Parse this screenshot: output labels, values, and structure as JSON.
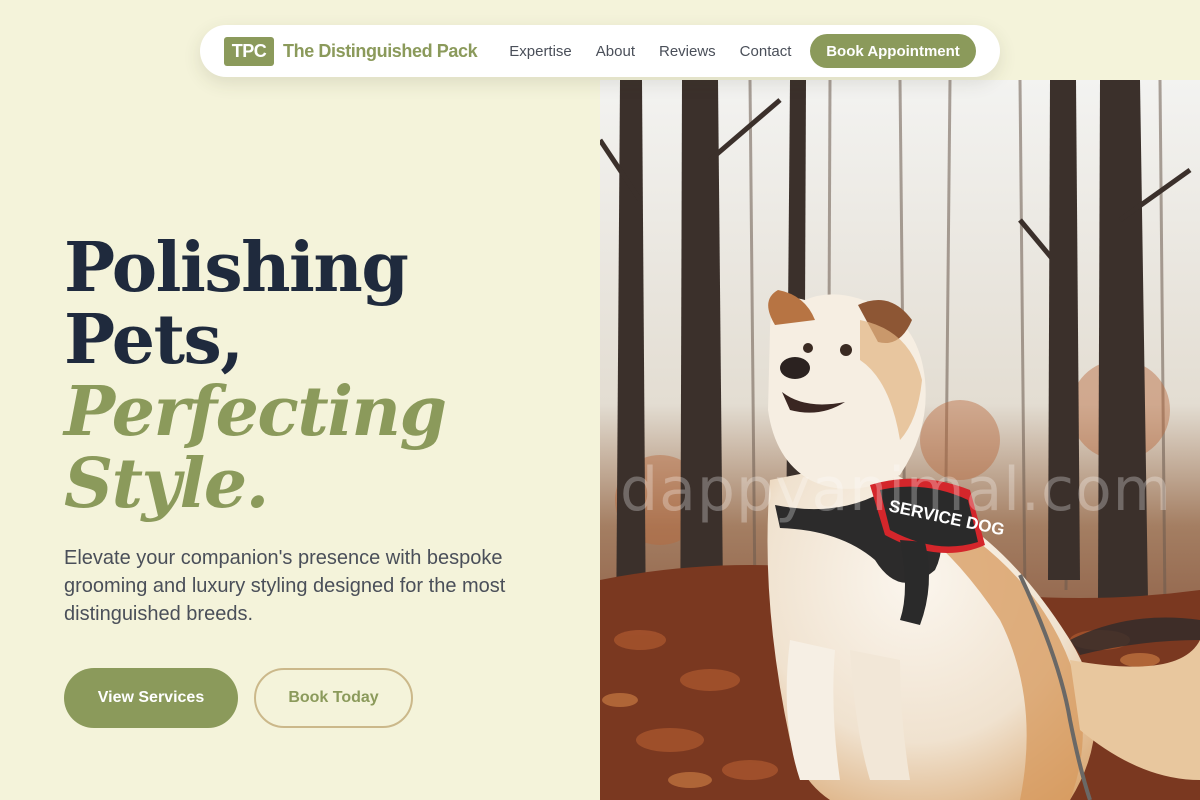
{
  "nav": {
    "logo_badge": "TPC",
    "logo_name": "The Distinguished Pack",
    "links": [
      "Expertise",
      "About",
      "Reviews",
      "Contact"
    ],
    "cta_label": "Book Appointment"
  },
  "hero": {
    "title_line1": "Polishing",
    "title_line2": "Pets,",
    "title_line3": "Perfecting",
    "title_line4": "Style.",
    "subtitle": "Elevate your companion's presence with bespoke grooming and luxury styling designed for the most distinguished breeds.",
    "primary_button": "View Services",
    "secondary_button": "Book Today",
    "harness_text": "SERVICE DOG",
    "watermark": "dappyanimal.com"
  },
  "colors": {
    "background": "#f4f3da",
    "accent": "#8b9a5b",
    "heading": "#1f2a3d",
    "body_text": "#4a4f59",
    "outline": "#cbb88a"
  }
}
